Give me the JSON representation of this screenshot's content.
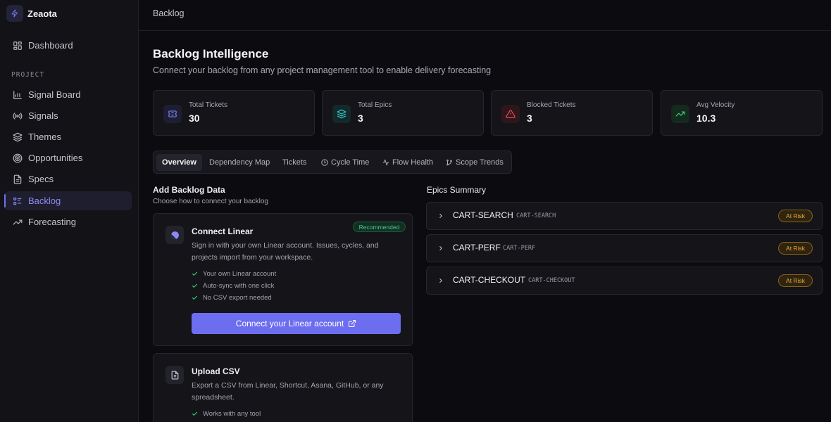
{
  "app": {
    "name": "Zeaota"
  },
  "sidebar": {
    "top_item": {
      "label": "Dashboard",
      "icon": "dashboard-grid-icon"
    },
    "section_label": "PROJECT",
    "items": [
      {
        "label": "Signal Board",
        "icon": "bar-chart-icon"
      },
      {
        "label": "Signals",
        "icon": "radio-waves-icon"
      },
      {
        "label": "Themes",
        "icon": "layers-icon"
      },
      {
        "label": "Opportunities",
        "icon": "target-icon"
      },
      {
        "label": "Specs",
        "icon": "document-icon"
      },
      {
        "label": "Backlog",
        "icon": "list-icon",
        "active": true
      },
      {
        "label": "Forecasting",
        "icon": "trending-up-icon"
      }
    ]
  },
  "topbar": {
    "title": "Backlog"
  },
  "page": {
    "title": "Backlog Intelligence",
    "subtitle": "Connect your backlog from any project management tool to enable delivery forecasting"
  },
  "stats": [
    {
      "label": "Total Tickets",
      "value": "30",
      "icon": "ticket-icon",
      "color": "#7b7bf0"
    },
    {
      "label": "Total Epics",
      "value": "3",
      "icon": "layers-icon",
      "color": "#2fc6c6"
    },
    {
      "label": "Blocked Tickets",
      "value": "3",
      "icon": "alert-triangle-icon",
      "color": "#f04a5a"
    },
    {
      "label": "Avg Velocity",
      "value": "10.3",
      "icon": "trending-up-icon",
      "color": "#3ccf78"
    }
  ],
  "tabs": [
    {
      "label": "Overview",
      "active": true
    },
    {
      "label": "Dependency Map"
    },
    {
      "label": "Tickets"
    },
    {
      "label": "Cycle Time",
      "icon": "clock-icon"
    },
    {
      "label": "Flow Health",
      "icon": "activity-icon"
    },
    {
      "label": "Scope Trends",
      "icon": "git-branch-icon"
    }
  ],
  "add_data": {
    "title": "Add Backlog Data",
    "subtitle": "Choose how to connect your backlog",
    "linear": {
      "title": "Connect Linear",
      "badge": "Recommended",
      "description": "Sign in with your own Linear account. Issues, cycles, and projects import from your workspace.",
      "features": [
        "Your own Linear account",
        "Auto-sync with one click",
        "No CSV export needed"
      ],
      "button": "Connect your Linear account"
    },
    "csv": {
      "title": "Upload CSV",
      "description": "Export a CSV from Linear, Shortcut, Asana, GitHub, or any spreadsheet.",
      "features": [
        "Works with any tool"
      ]
    }
  },
  "epics": {
    "title": "Epics Summary",
    "items": [
      {
        "name": "CART-SEARCH",
        "code": "CART-SEARCH",
        "status": "At Risk"
      },
      {
        "name": "CART-PERF",
        "code": "CART-PERF",
        "status": "At Risk"
      },
      {
        "name": "CART-CHECKOUT",
        "code": "CART-CHECKOUT",
        "status": "At Risk"
      }
    ]
  },
  "colors": {
    "accent": "#6d6df0",
    "success": "#4ec98a",
    "warning": "#f0a83a",
    "danger": "#f04a5a"
  }
}
